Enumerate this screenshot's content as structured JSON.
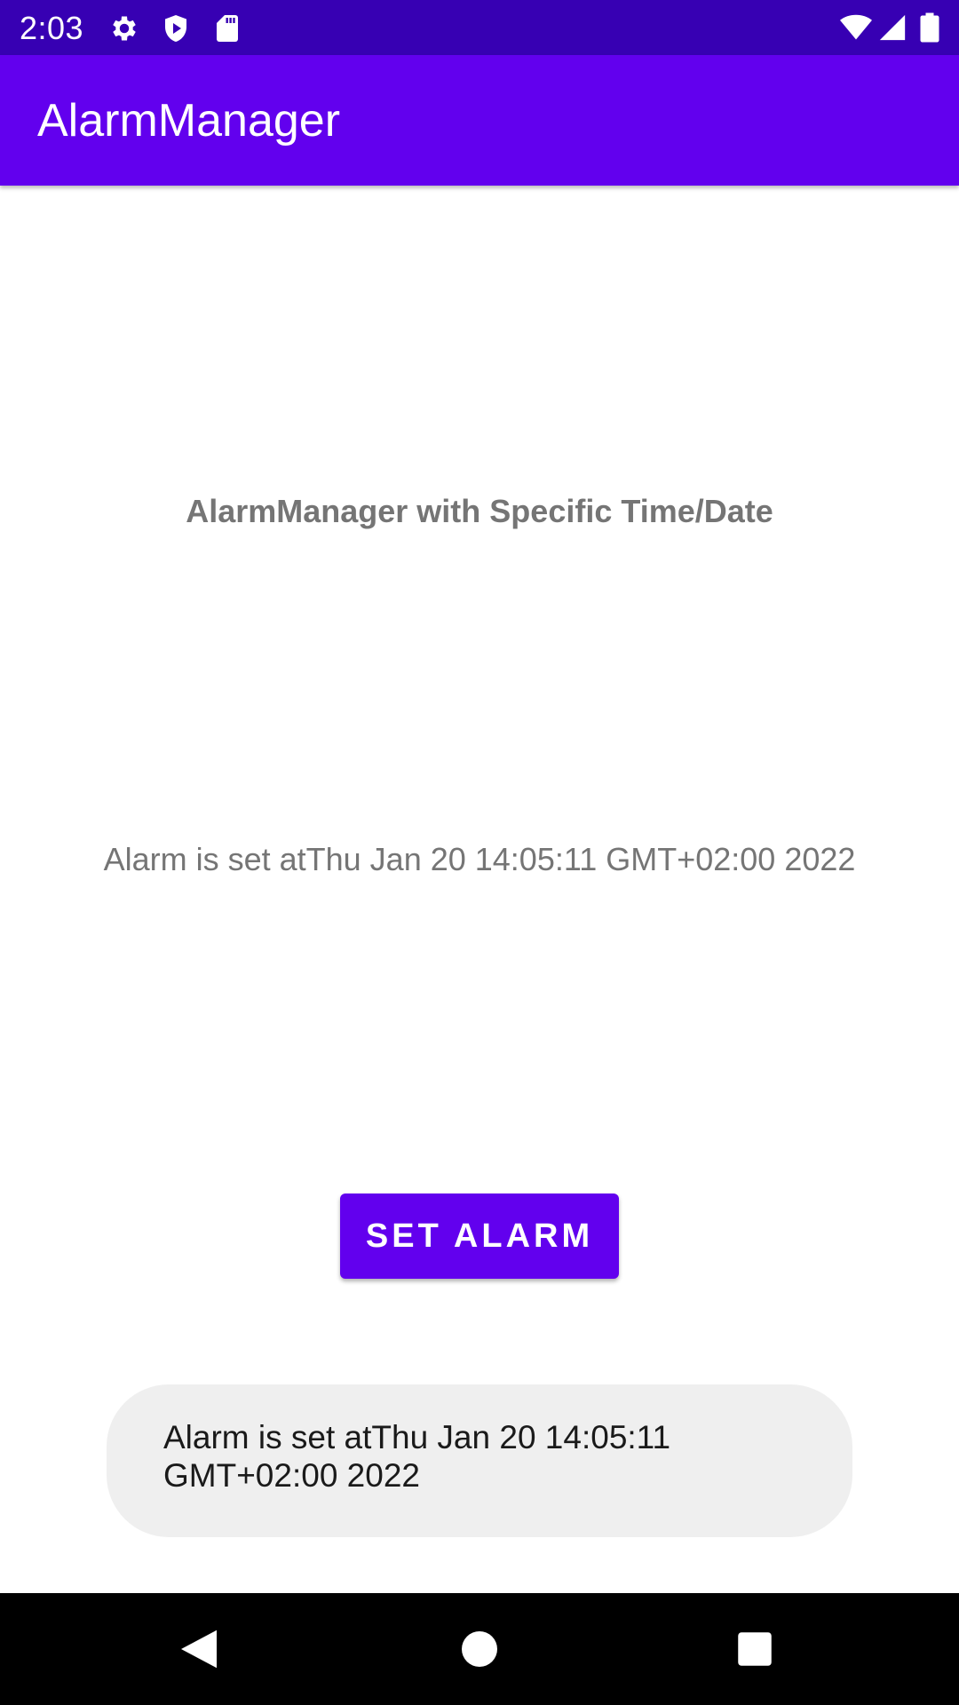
{
  "status_bar": {
    "time": "2:03",
    "left_icons": [
      "gear-icon",
      "shield-play-icon",
      "sd-card-icon"
    ],
    "right_icons": [
      "wifi-icon",
      "cell-signal-icon",
      "battery-icon"
    ],
    "background": "#3700b3"
  },
  "app_bar": {
    "title": "AlarmManager",
    "background": "#6200ee"
  },
  "main": {
    "heading": "AlarmManager with Specific Time/Date",
    "alarm_status": "Alarm is set atThu Jan 20 14:05:11 GMT+02:00 2022",
    "set_alarm_label": "SET ALARM",
    "accent": "#6200ee"
  },
  "toast": {
    "line1": "Alarm is set atThu Jan 20 14:05:11",
    "line2": "GMT+02:00 2022"
  },
  "nav_bar": {
    "buttons": [
      "back-icon",
      "home-icon",
      "recents-icon"
    ]
  }
}
